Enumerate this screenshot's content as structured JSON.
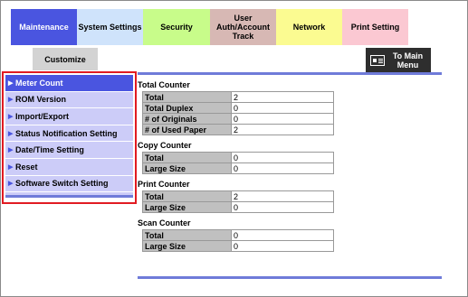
{
  "tabs": [
    {
      "label": "Maintenance"
    },
    {
      "label": "System Settings"
    },
    {
      "label": "Security"
    },
    {
      "label": "User\nAuth/Account\nTrack"
    },
    {
      "label": "Network"
    },
    {
      "label": "Print Setting"
    }
  ],
  "subtab": {
    "label": "Customize"
  },
  "main_menu": {
    "label": "To Main\nMenu",
    "icon": "menu-icon"
  },
  "sidebar": {
    "items": [
      {
        "label": "Meter Count"
      },
      {
        "label": "ROM Version"
      },
      {
        "label": "Import/Export"
      },
      {
        "label": "Status Notification Setting"
      },
      {
        "label": "Date/Time Setting"
      },
      {
        "label": "Reset"
      },
      {
        "label": "Software Switch Setting"
      }
    ]
  },
  "sections": {
    "total": {
      "title": "Total Counter",
      "rows": [
        {
          "label": "Total",
          "value": "2"
        },
        {
          "label": "Total Duplex",
          "value": "0"
        },
        {
          "label": "# of Originals",
          "value": "0"
        },
        {
          "label": "# of Used Paper",
          "value": "2"
        }
      ]
    },
    "copy": {
      "title": "Copy Counter",
      "rows": [
        {
          "label": "Total",
          "value": "0"
        },
        {
          "label": "Large Size",
          "value": "0"
        }
      ]
    },
    "print": {
      "title": "Print Counter",
      "rows": [
        {
          "label": "Total",
          "value": "2"
        },
        {
          "label": "Large Size",
          "value": "0"
        }
      ]
    },
    "scan": {
      "title": "Scan Counter",
      "rows": [
        {
          "label": "Total",
          "value": "0"
        },
        {
          "label": "Large Size",
          "value": "0"
        }
      ]
    }
  },
  "colors": {
    "accent": "#4a55e0",
    "highlight_box": "#e11b22"
  }
}
